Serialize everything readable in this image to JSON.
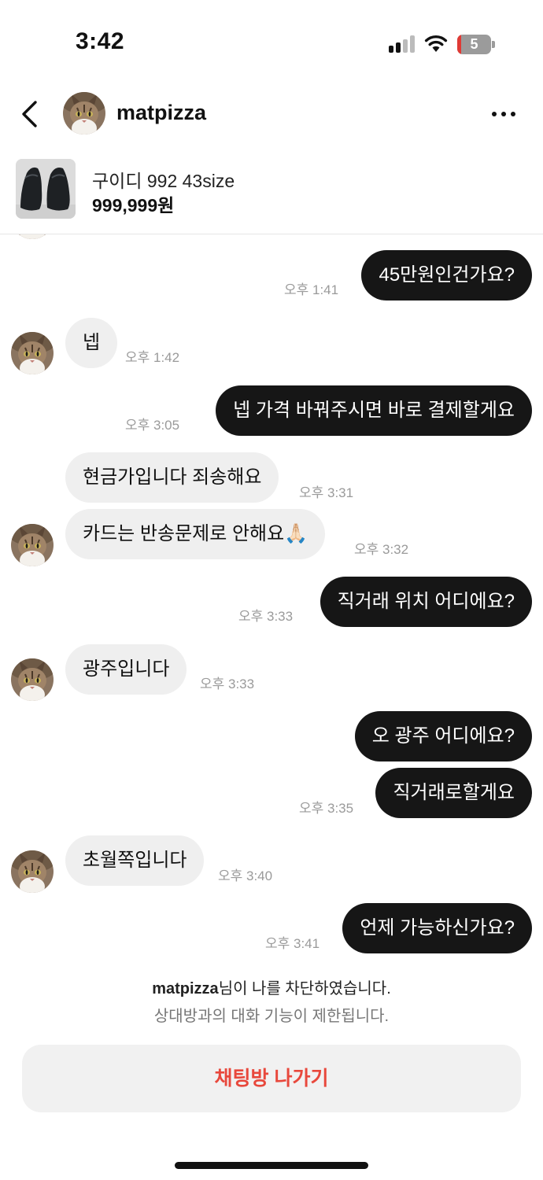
{
  "status_bar": {
    "time": "3:42",
    "battery_level": "5"
  },
  "header": {
    "username": "matpizza"
  },
  "product": {
    "name": "구이디 992 43size",
    "price": "999,999원"
  },
  "messages": [
    {
      "from": "me",
      "text": "45만원인건가요?",
      "time": "오후 1:41"
    },
    {
      "from": "them",
      "text": "넵",
      "time": "오후 1:42"
    },
    {
      "from": "me",
      "text": "넵 가격 바꿔주시면 바로 결제할게요",
      "time": "오후 3:05"
    },
    {
      "from": "them",
      "text": "현금가입니다 죄송해요",
      "time": "오후 3:31"
    },
    {
      "from": "them",
      "text": "카드는 반송문제로 안해요🙏🏻",
      "time": "오후 3:32"
    },
    {
      "from": "me",
      "text": "직거래 위치 어디에요?",
      "time": "오후 3:33"
    },
    {
      "from": "them",
      "text": "광주입니다",
      "time": "오후 3:33"
    },
    {
      "from": "me",
      "text": "오 광주 어디에요?",
      "time": ""
    },
    {
      "from": "me",
      "text": "직거래로할게요",
      "time": "오후 3:35"
    },
    {
      "from": "them",
      "text": "초월쪽입니다",
      "time": "오후 3:40"
    },
    {
      "from": "me",
      "text": "언제 가능하신가요?",
      "time": "오후 3:41"
    }
  ],
  "notice": {
    "blocked_user": "matpizza",
    "blocked_suffix": "님이 나를 차단하였습니다.",
    "restriction": "상대방과의 대화 기능이 제한됩니다."
  },
  "leave_button": "채팅방 나가기",
  "colors": {
    "outgoing_bubble": "#161616",
    "incoming_bubble": "#efefef",
    "leave_text": "#e8483c",
    "battery_low": "#e03a35"
  }
}
